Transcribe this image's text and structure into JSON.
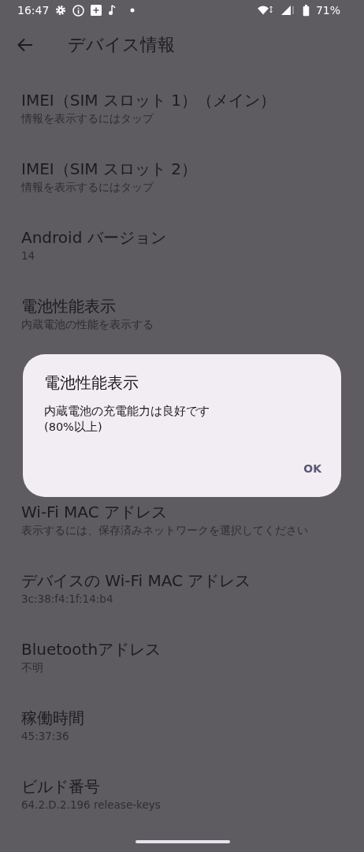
{
  "status_bar": {
    "time": "16:47",
    "battery": "71%"
  },
  "app_bar": {
    "title": "デバイス情報"
  },
  "items_above": [
    {
      "title": "IMEI（SIM スロット 1）（メイン）",
      "summary": "情報を表示するにはタップ"
    },
    {
      "title": "IMEI（SIM スロット 2）",
      "summary": "情報を表示するにはタップ"
    },
    {
      "title": "Android バージョン",
      "summary": "14"
    },
    {
      "title": "電池性能表示",
      "summary": "内蔵電池の性能を表示する"
    }
  ],
  "items_below": [
    {
      "title": "Wi-Fi MAC アドレス",
      "summary": "表示するには、保存済みネットワークを選択してください"
    },
    {
      "title": "デバイスの Wi-Fi MAC アドレス",
      "summary": "3c:38:f4:1f:14:b4"
    },
    {
      "title": "Bluetoothアドレス",
      "summary": "不明"
    },
    {
      "title": "稼働時間",
      "summary": "45:37:36"
    },
    {
      "title": "ビルド番号",
      "summary": "64.2.D.2.196 release-keys"
    }
  ],
  "dialog": {
    "title": "電池性能表示",
    "message": "内蔵電池の充電能力は良好です\n(80%以上)",
    "button": "OK"
  }
}
